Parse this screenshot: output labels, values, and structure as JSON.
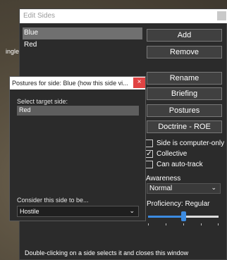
{
  "background": {
    "partial_text": "ingle"
  },
  "main_window": {
    "title": "Edit Sides",
    "sides": [
      "Blue",
      "Red"
    ],
    "selected_side_index": 0,
    "buttons": {
      "add": "Add",
      "remove": "Remove",
      "rename": "Rename",
      "briefing": "Briefing",
      "postures": "Postures",
      "doctrine": "Doctrine - ROE"
    },
    "checkboxes": [
      {
        "label": "Side is computer-only",
        "checked": false
      },
      {
        "label": "Collective",
        "checked": true
      },
      {
        "label": "Can auto-track",
        "checked": false
      }
    ],
    "awareness_label": "Awareness",
    "awareness_value": "Normal",
    "proficiency_label": "Proficiency: Regular",
    "proficiency_level": 0.5,
    "footer": "Double-clicking on a side selects it and closes this window"
  },
  "postures_dialog": {
    "title": "Postures for side: Blue (how this side vi...",
    "close_glyph": "×",
    "select_target_label": "Select target side:",
    "target_sides": [
      "Red"
    ],
    "consider_label": "Consider this side to be...",
    "consider_value": "Hostile"
  },
  "icons": {
    "chevron": "⌄",
    "checkmark": "✓"
  },
  "colors": {
    "window_bg": "#2b2b2b",
    "selection_bg": "#707070",
    "close_red": "#e04343",
    "slider_accent": "#3c8be0"
  }
}
